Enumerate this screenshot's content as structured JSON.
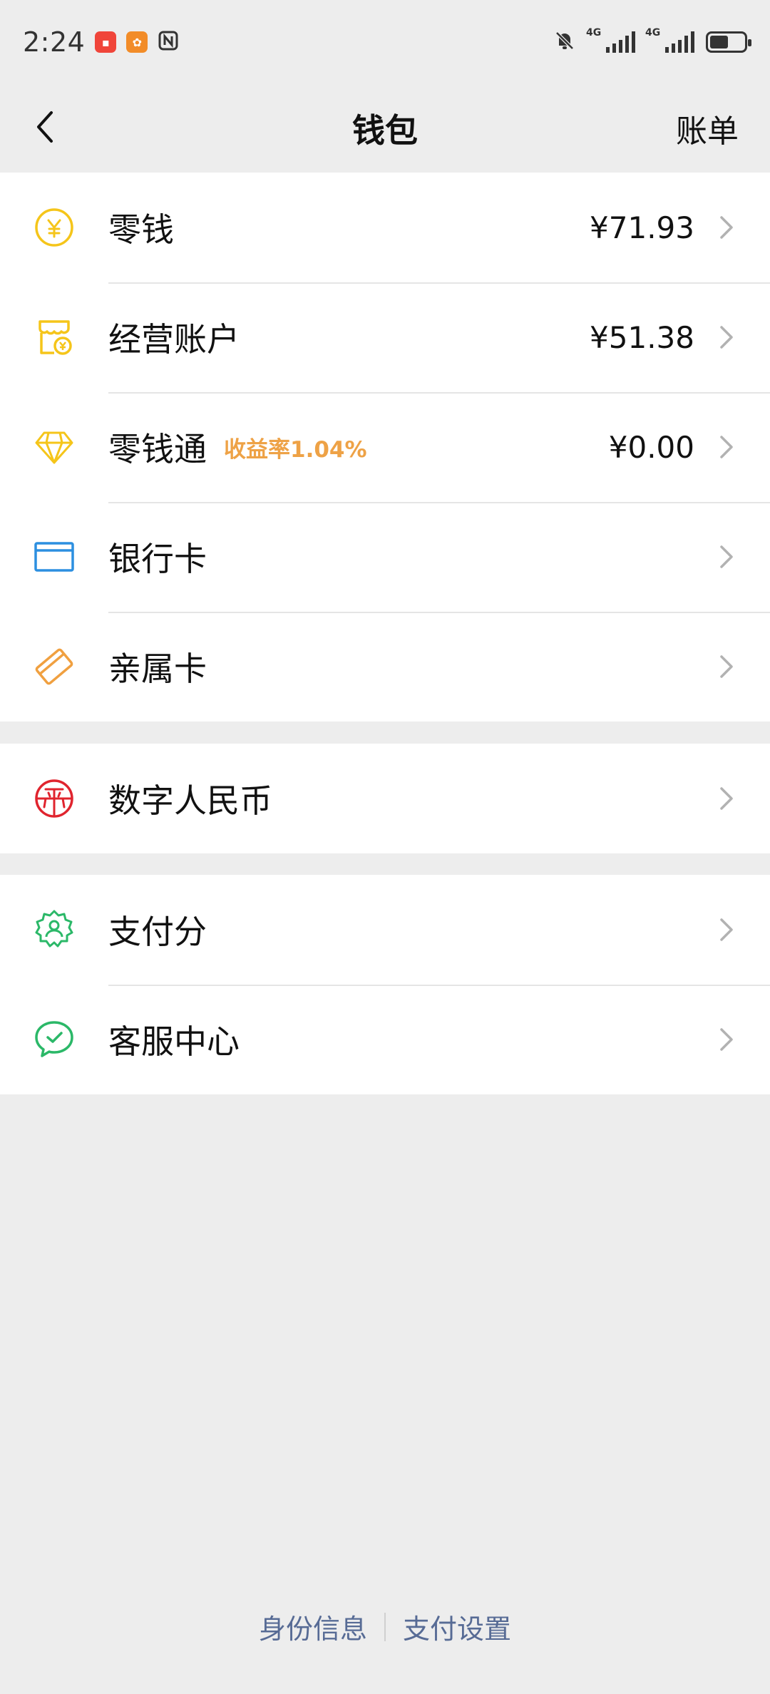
{
  "status_bar": {
    "time": "2:24",
    "app_icons": [
      "red-app-icon",
      "orange-app-icon",
      "nfc-icon"
    ],
    "network_labels": [
      "4G",
      "4G"
    ],
    "battery_level": 0.55
  },
  "nav": {
    "title": "钱包",
    "right_label": "账单"
  },
  "groups": [
    {
      "items": [
        {
          "label": "零钱",
          "value": "¥71.93",
          "icon": "yuan-coin-icon",
          "color": "#F5C51A"
        },
        {
          "label": "经营账户",
          "value": "¥51.38",
          "icon": "shop-account-icon",
          "color": "#F5C51A"
        },
        {
          "label": "零钱通",
          "tag": "收益率1.04%",
          "value": "¥0.00",
          "icon": "diamond-icon",
          "color": "#F5C51A"
        },
        {
          "label": "银行卡",
          "value": "",
          "icon": "bank-card-icon",
          "color": "#2C8FE0"
        },
        {
          "label": "亲属卡",
          "value": "",
          "icon": "family-card-icon",
          "color": "#F0A040"
        }
      ]
    },
    {
      "items": [
        {
          "label": "数字人民币",
          "value": "",
          "icon": "digital-rmb-icon",
          "color": "#E0242E"
        }
      ]
    },
    {
      "items": [
        {
          "label": "支付分",
          "value": "",
          "icon": "pay-score-icon",
          "color": "#2BB868"
        },
        {
          "label": "客服中心",
          "value": "",
          "icon": "customer-service-icon",
          "color": "#2BB868"
        }
      ]
    }
  ],
  "footer": {
    "identity_label": "身份信息",
    "settings_label": "支付设置"
  },
  "colors": {
    "background": "#EDEDED",
    "link": "#576B95",
    "tag": "#EEA246"
  }
}
